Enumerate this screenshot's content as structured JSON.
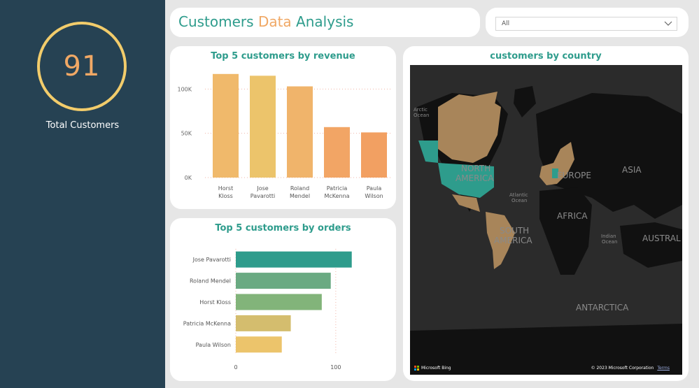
{
  "kpi": {
    "value": "91",
    "label": "Total Customers"
  },
  "header": {
    "title_part1": "Customers ",
    "title_accent": "Data",
    "title_part2": " Analysis"
  },
  "filter": {
    "selected": "All"
  },
  "revenue_chart": {
    "title": "Top 5 customers by revenue",
    "colors": [
      "#f0b96b",
      "#ecc46b",
      "#f0b46b",
      "#f2a565",
      "#f2a062"
    ]
  },
  "orders_chart": {
    "title": "Top 5 customers by orders",
    "colors": [
      "#2e9c8c",
      "#6aaa82",
      "#82b47a",
      "#d4bd6e",
      "#ecc46b"
    ]
  },
  "map": {
    "title": "customers by country",
    "labels": {
      "arctic": "Arctic\nOcean",
      "north_america": "NORTH\nAMERICA",
      "europe": "EUROPE",
      "asia": "ASIA",
      "atlantic": "Atlantic\nOcean",
      "africa": "AFRICA",
      "south_america": "SOUTH\nAMERICA",
      "indian": "Indian\nOcean",
      "australia": "AUSTRAL",
      "antarctica": "ANTARCTICA"
    },
    "bing": "Microsoft Bing",
    "copyright": "© 2023 Microsoft Corporation",
    "terms": "Terms"
  },
  "chart_data": [
    {
      "type": "bar",
      "title": "Top 5 customers by revenue",
      "categories": [
        "Horst Kloss",
        "Jose Pavarotti",
        "Roland Mendel",
        "Patricia McKenna",
        "Paula Wilson"
      ],
      "values": [
        117000,
        115000,
        103000,
        57000,
        51000
      ],
      "yticks": [
        "0K",
        "50K",
        "100K"
      ],
      "ylim": [
        0,
        120000
      ],
      "grid": true
    },
    {
      "type": "bar",
      "orientation": "horizontal",
      "title": "Top 5 customers by orders",
      "categories": [
        "Jose Pavarotti",
        "Roland Mendel",
        "Horst Kloss",
        "Patricia McKenna",
        "Paula Wilson"
      ],
      "values": [
        116,
        95,
        86,
        55,
        46
      ],
      "xticks": [
        "0",
        "100"
      ],
      "xlim": [
        0,
        140
      ],
      "grid": true
    }
  ]
}
